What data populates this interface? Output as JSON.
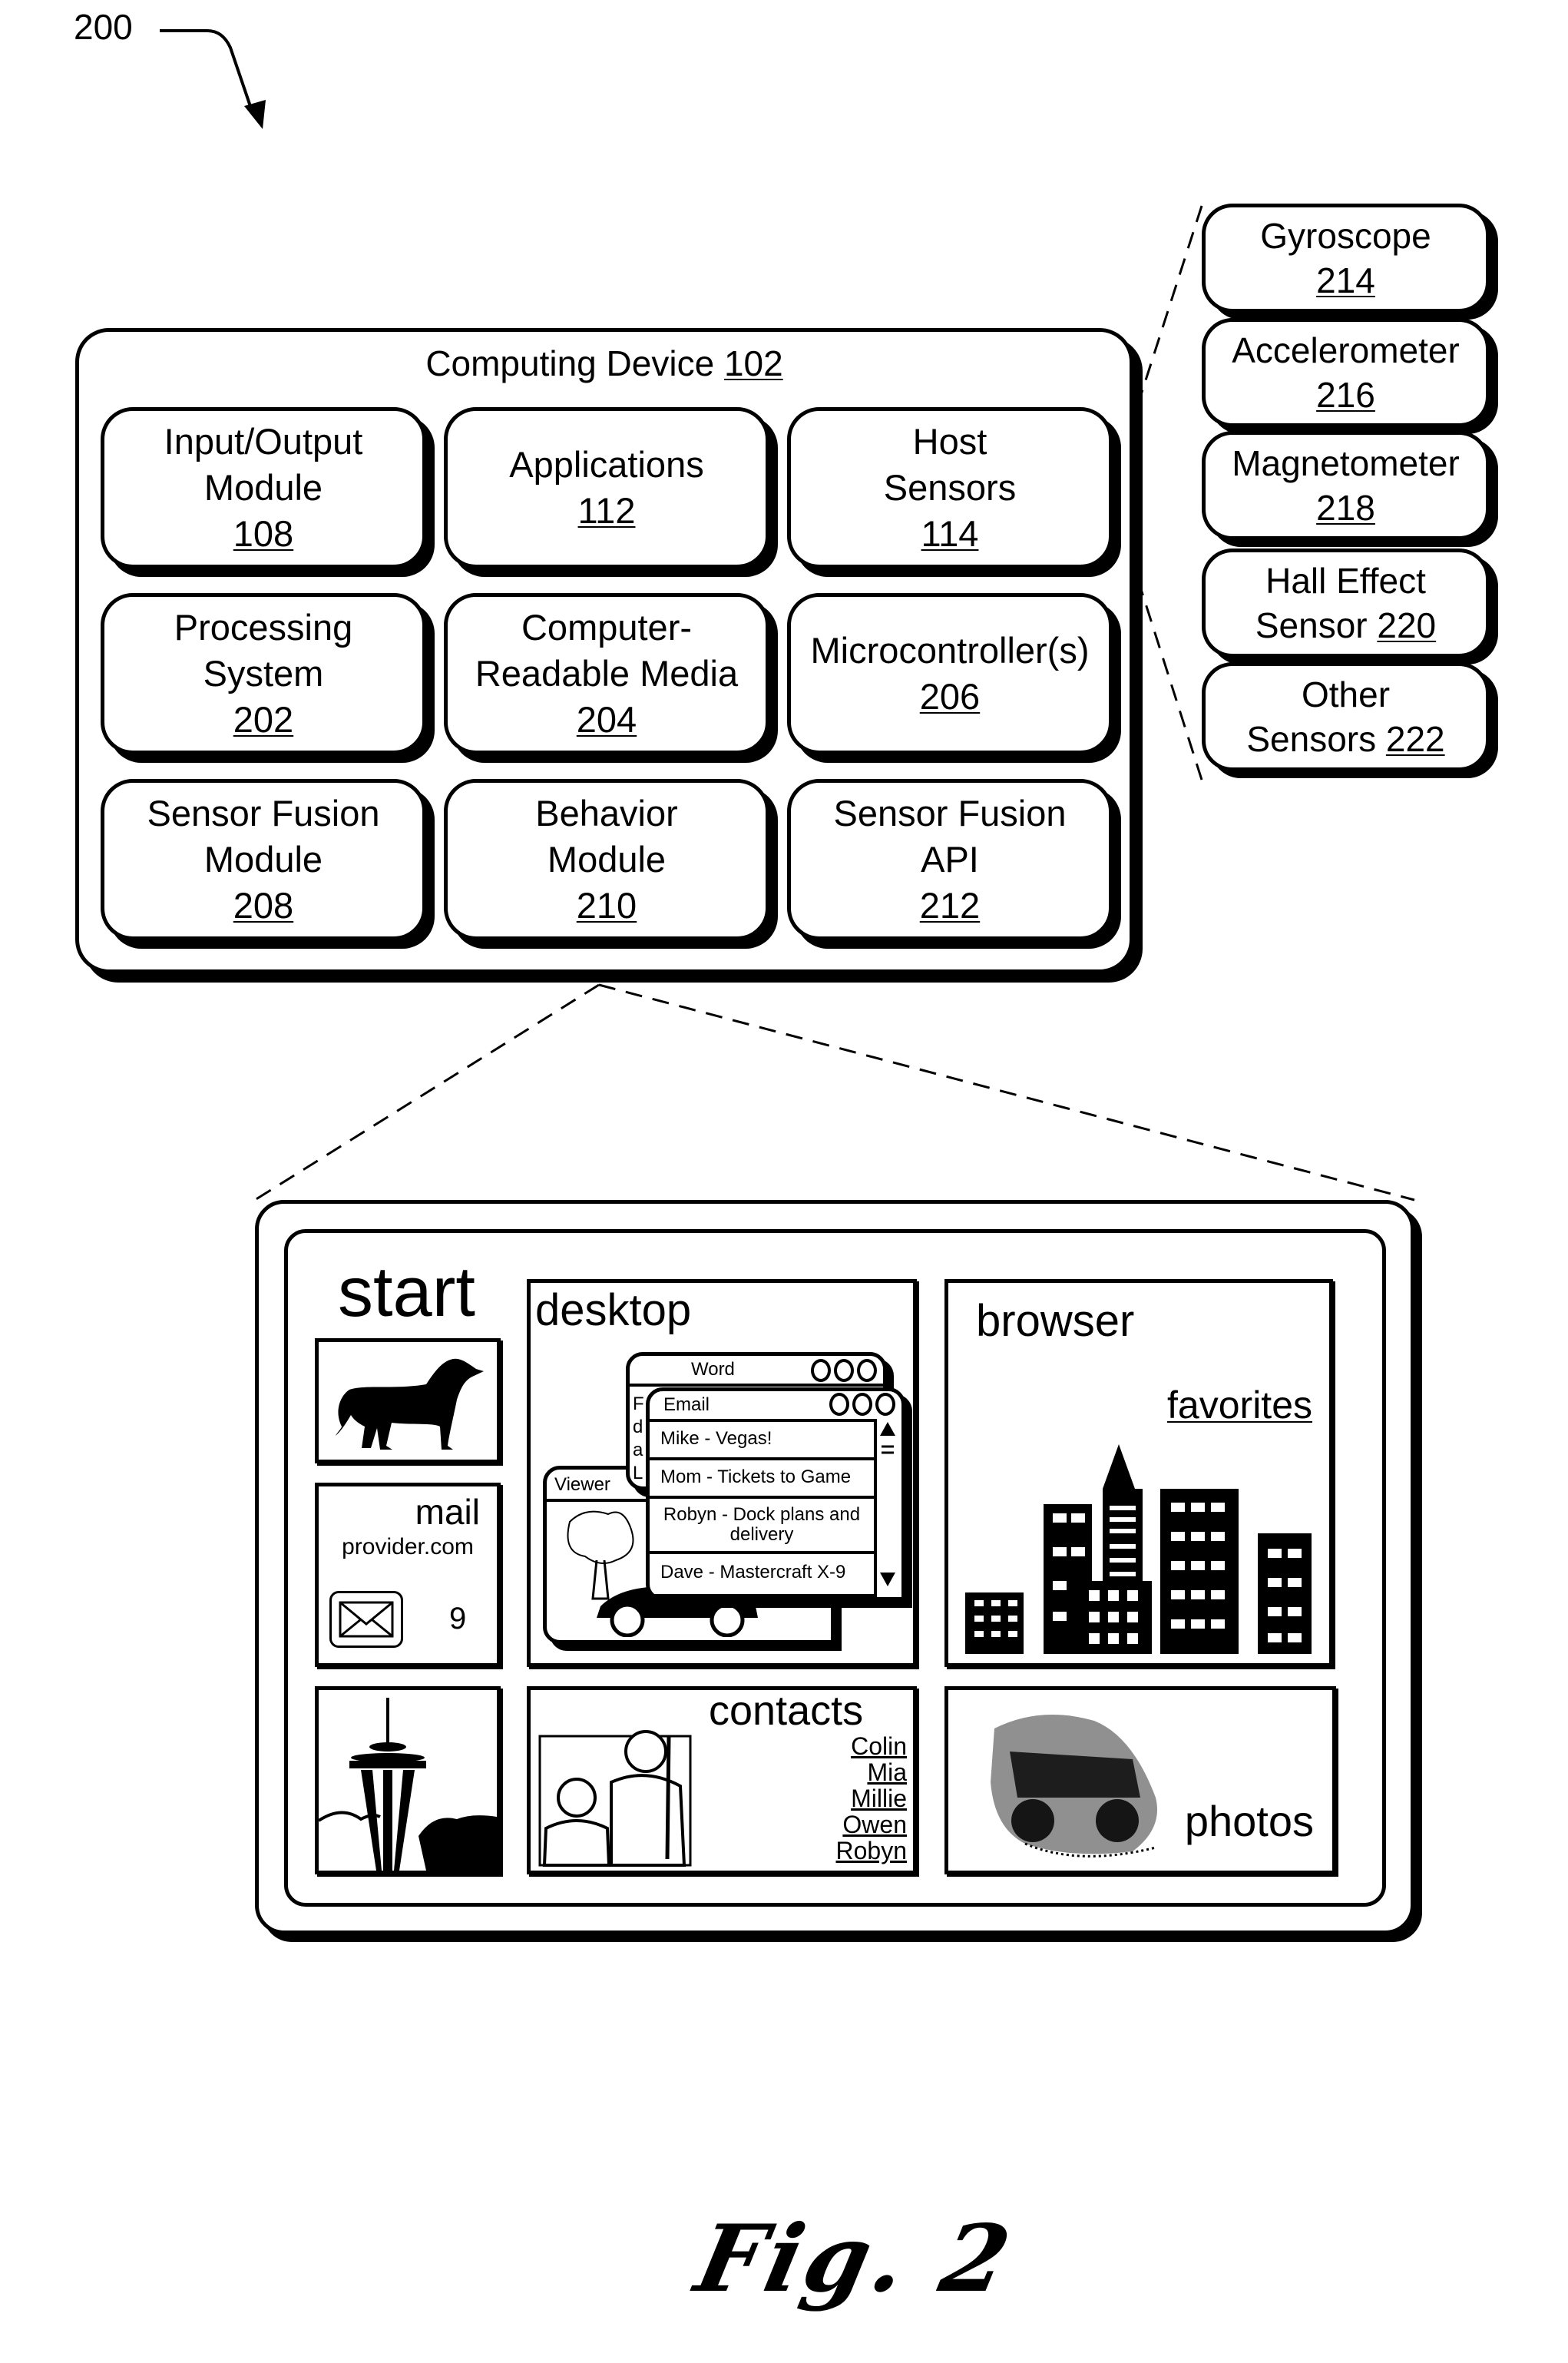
{
  "figure": {
    "reference": "200",
    "caption": "Fig. 2"
  },
  "computing_device": {
    "title": "Computing Device",
    "ref": "102",
    "modules": [
      {
        "lines": [
          "Input/Output",
          "Module"
        ],
        "ref": "108"
      },
      {
        "lines": [
          "Applications"
        ],
        "ref": "112"
      },
      {
        "lines": [
          "Host",
          "Sensors"
        ],
        "ref": "114"
      },
      {
        "lines": [
          "Processing",
          "System"
        ],
        "ref": "202"
      },
      {
        "lines": [
          "Computer-",
          "Readable Media"
        ],
        "ref": "204"
      },
      {
        "lines": [
          "Microcontroller(s)"
        ],
        "ref": "206"
      },
      {
        "lines": [
          "Sensor Fusion",
          "Module"
        ],
        "ref": "208"
      },
      {
        "lines": [
          "Behavior",
          "Module"
        ],
        "ref": "210"
      },
      {
        "lines": [
          "Sensor Fusion",
          "API"
        ],
        "ref": "212"
      }
    ]
  },
  "host_sensors": [
    {
      "lines": [
        "Gyroscope"
      ],
      "ref": "214"
    },
    {
      "lines": [
        "Accelerometer"
      ],
      "ref": "216"
    },
    {
      "lines": [
        "Magnetometer"
      ],
      "ref": "218"
    },
    {
      "lines": [
        "Hall Effect",
        "Sensor"
      ],
      "ref": "220"
    },
    {
      "lines": [
        "Other",
        "Sensors"
      ],
      "ref": "222"
    }
  ],
  "tablet": {
    "start_label": "start",
    "mail": {
      "title": "mail",
      "provider": "provider.com",
      "unread_count": "9"
    },
    "desktop": {
      "title": "desktop",
      "word_window_title": "Word",
      "word_partial_text": [
        "F",
        "d",
        "a",
        "L"
      ],
      "viewer_window_title": "Viewer",
      "email_window_title": "Email",
      "emails": [
        "Mike - Vegas!",
        "Mom - Tickets to Game",
        "Robyn - Dock plans and delivery",
        "Dave - Mastercraft X-9"
      ]
    },
    "browser": {
      "title": "browser",
      "favorites_link": "favorites"
    },
    "contacts": {
      "title": "contacts",
      "names": [
        "Colin",
        "Mia",
        "Millie",
        "Owen",
        "Robyn"
      ]
    },
    "photos": {
      "title": "photos"
    }
  }
}
